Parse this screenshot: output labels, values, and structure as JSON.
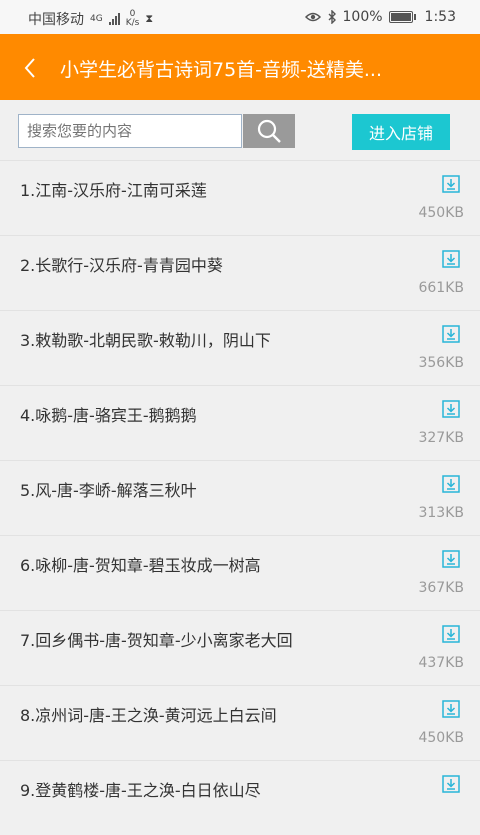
{
  "status_bar": {
    "carrier": "中国移动",
    "network": "4G",
    "speed_value": "0",
    "speed_unit": "K/s",
    "battery": "100%",
    "time": "1:53"
  },
  "header": {
    "title": "小学生必背古诗词75首-音频-送精美..."
  },
  "search": {
    "placeholder": "搜索您要的内容",
    "store_button": "进入店铺"
  },
  "items": [
    {
      "name": "1.江南-汉乐府-江南可采莲",
      "size": "450KB"
    },
    {
      "name": "2.长歌行-汉乐府-青青园中葵",
      "size": "661KB"
    },
    {
      "name": "3.敕勒歌-北朝民歌-敕勒川，阴山下",
      "size": "356KB"
    },
    {
      "name": "4.咏鹅-唐-骆宾王-鹅鹅鹅",
      "size": "327KB"
    },
    {
      "name": "5.风-唐-李峤-解落三秋叶",
      "size": "313KB"
    },
    {
      "name": "6.咏柳-唐-贺知章-碧玉妆成一树高",
      "size": "367KB"
    },
    {
      "name": "7.回乡偶书-唐-贺知章-少小离家老大回",
      "size": "437KB"
    },
    {
      "name": "8.凉州词-唐-王之涣-黄河远上白云间",
      "size": "450KB"
    },
    {
      "name": "9.登黄鹤楼-唐-王之涣-白日依山尽",
      "size": ""
    }
  ],
  "colors": {
    "header_bg": "#ff8a00",
    "store_button_bg": "#1cc7d1",
    "download_icon": "#29b6d8"
  },
  "icons": {
    "back": "back-arrow-icon",
    "search": "search-icon",
    "download": "download-icon"
  }
}
